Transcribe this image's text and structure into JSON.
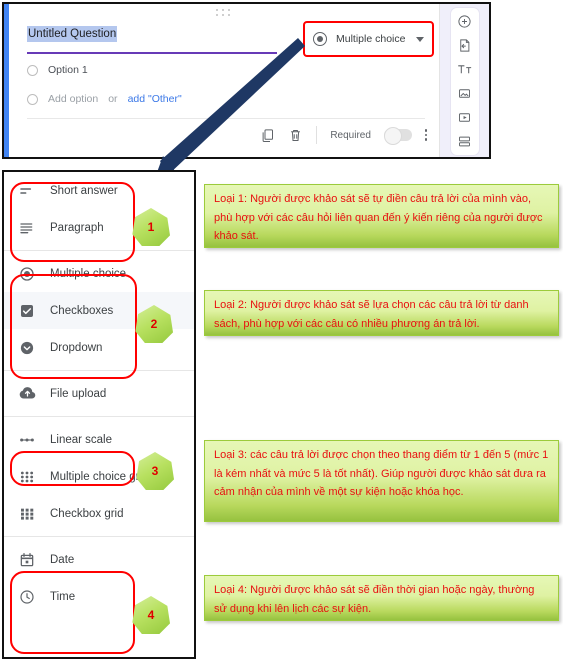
{
  "forms_card": {
    "question_title": "Untitled Question",
    "options": [
      {
        "label": "Option 1",
        "muted": false
      },
      {
        "label": "Add option",
        "or_text": "or",
        "other_link": "add \"Other\""
      }
    ],
    "footer": {
      "duplicate_icon": "duplicate-icon",
      "delete_icon": "trash-icon",
      "required_label": "Required",
      "toggle_state": "off",
      "more_icon": "more-vert-icon"
    },
    "type_selector": {
      "icon": "radio-selected-icon",
      "label": "Multiple choice",
      "caret": "chevron-down-icon"
    },
    "right_rail": [
      "add-question-icon",
      "import-questions-icon",
      "add-title-icon",
      "add-image-icon",
      "add-video-icon",
      "add-section-icon"
    ]
  },
  "type_menu": {
    "groups": [
      {
        "badge": "1",
        "items": [
          {
            "icon": "short-answer-icon",
            "label": "Short answer",
            "selected": false
          },
          {
            "icon": "paragraph-icon",
            "label": "Paragraph",
            "selected": false
          }
        ]
      },
      {
        "badge": "2",
        "items": [
          {
            "icon": "radio-selected-icon",
            "label": "Multiple choice",
            "selected": false
          },
          {
            "icon": "checkbox-icon",
            "label": "Checkboxes",
            "selected": true
          },
          {
            "icon": "dropdown-icon",
            "label": "Dropdown",
            "selected": false
          }
        ]
      },
      {
        "badge": null,
        "items": [
          {
            "icon": "file-upload-icon",
            "label": "File upload",
            "selected": false
          }
        ]
      },
      {
        "badge": "3",
        "items": [
          {
            "icon": "linear-scale-icon",
            "label": "Linear scale",
            "selected": false
          }
        ]
      },
      {
        "badge": null,
        "items": [
          {
            "icon": "multiple-choice-grid-icon",
            "label": "Multiple choice grid",
            "selected": false
          },
          {
            "icon": "checkbox-grid-icon",
            "label": "Checkbox grid",
            "selected": false
          }
        ]
      },
      {
        "badge": "4",
        "items": [
          {
            "icon": "date-icon",
            "label": "Date",
            "selected": false
          },
          {
            "icon": "time-icon",
            "label": "Time",
            "selected": false
          }
        ]
      }
    ]
  },
  "notes": [
    {
      "text": "Loại 1: Người được khảo sát sẽ tự điền câu trả lời của mình vào, phù hợp với các câu hỏi liên quan đến ý kiến riêng của người được khảo sát."
    },
    {
      "text": "Loại 2: Người được khảo sát sẽ lựa chọn các câu trả lời từ danh sách, phù hợp với các câu có nhiều phương án trả lời."
    },
    {
      "text": "Loại 3: các câu trả lời được chọn theo thang điểm từ 1 đến 5 (mức 1 là kém nhất và mức 5 là tốt nhất). Giúp người được khảo sát đưa ra cảm nhận của mình về một sự kiện hoặc khóa học."
    },
    {
      "text": "Loại 4: Người được khảo sát sẽ điền thời gian hoặc ngày, thường sử dụng khi lên lịch các sự kiện."
    }
  ],
  "colors": {
    "highlight_red": "#ff0000",
    "note_text_red": "#e81010",
    "accent_purple": "#673ab7",
    "card_blue": "#4285f4",
    "arrow_navy": "#1f3864",
    "badge_green": "#b7e05f"
  }
}
